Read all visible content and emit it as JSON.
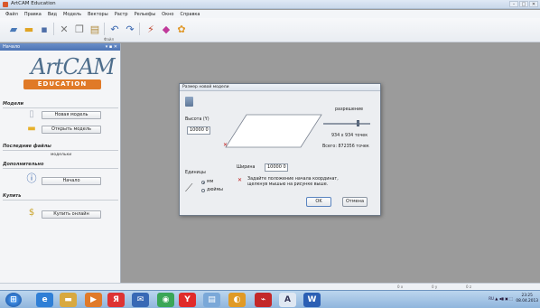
{
  "window": {
    "title": "ArtCAM Education",
    "controls": [
      "–",
      "□",
      "✕"
    ]
  },
  "menu": [
    "Файл",
    "Правка",
    "Вид",
    "Модель",
    "Векторы",
    "Растр",
    "Рельефы",
    "Окно",
    "Справка"
  ],
  "toolbar": {
    "label": "Файл"
  },
  "panel": {
    "header": "Начало",
    "header_controls": "▾ ▪ ✕",
    "logo_art": "ArtCAM",
    "logo_edu": "EDUCATION",
    "sections": {
      "models_title": "Модели",
      "new_model_btn": "Новая модель",
      "open_model_btn": "Открыть модель",
      "recent_title": "Последние файлы",
      "recent_item": "модельки",
      "extra_title": "Дополнительно",
      "start_btn": "Начало",
      "buy_title": "Купить",
      "buy_btn": "Купить онлайн"
    }
  },
  "dialog": {
    "title": "Размер новой модели",
    "height_label": "Высота (Y)",
    "height_value": "10000 0",
    "width_label": "Ширина",
    "width_value": "10000 0",
    "resolution_label": "разрешение",
    "resolution_value": "934 x 934 точек",
    "total_label": "Всего: 872356 точек",
    "units_label": "Единицы",
    "unit_mm": "мм",
    "unit_inch": "дюймы",
    "hint": "Задайте положение начала координат, щелкнув мышью на рисунке выше.",
    "ok": "OK",
    "cancel": "Отмена",
    "units_selected": "мм"
  },
  "statusbar": {
    "cells": [
      "0 x",
      "0 y",
      "0 z"
    ]
  },
  "taskbar": {
    "tray": "RU  ▲  ◀▮  ▣  ⬚",
    "time": "23:25",
    "date": "08.04.2013"
  }
}
